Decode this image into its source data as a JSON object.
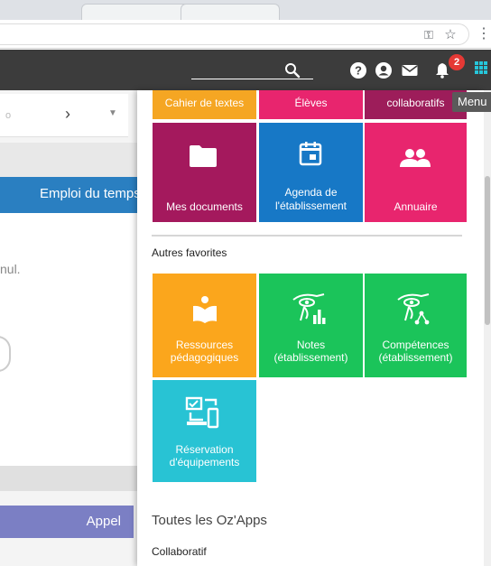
{
  "topbar": {
    "notification_count": "2",
    "tooltip": "Menu"
  },
  "background_page": {
    "select_value": "o",
    "tab_button": "Emploi du temps",
    "text_fragment": "nul.",
    "appel_button": "Appel"
  },
  "menu": {
    "top_row": [
      {
        "label": "Cahier de textes",
        "color": "#f5a623"
      },
      {
        "label": "Élèves",
        "color": "#e8256e"
      },
      {
        "label": "collaboratifs",
        "color": "#9d1d5a"
      }
    ],
    "row1": [
      {
        "label": "Mes documents",
        "icon": "folder-icon",
        "color": "#a4195d"
      },
      {
        "label_line1": "Agenda de",
        "label_line2": "l'établissement",
        "icon": "calendar-icon",
        "color": "#1778c6"
      },
      {
        "label": "Annuaire",
        "icon": "users-icon",
        "color": "#e8256e"
      }
    ],
    "favorites_title": "Autres favorites",
    "favorites": [
      {
        "label_line1": "Ressources",
        "label_line2": "pédagogiques",
        "icon": "book-icon",
        "color": "#fba61c"
      },
      {
        "label_line1": "Notes",
        "label_line2": "(établissement)",
        "icon": "notes-eye-icon",
        "color": "#1bc45a"
      },
      {
        "label_line1": "Compétences",
        "label_line2": "(établissement)",
        "icon": "skills-eye-icon",
        "color": "#1bc45a"
      },
      {
        "label_line1": "Réservation",
        "label_line2": "d'équipements",
        "icon": "devices-icon",
        "color": "#28c3d4"
      }
    ],
    "all_apps_title": "Toutes les Oz'Apps",
    "category_title": "Collaboratif"
  }
}
